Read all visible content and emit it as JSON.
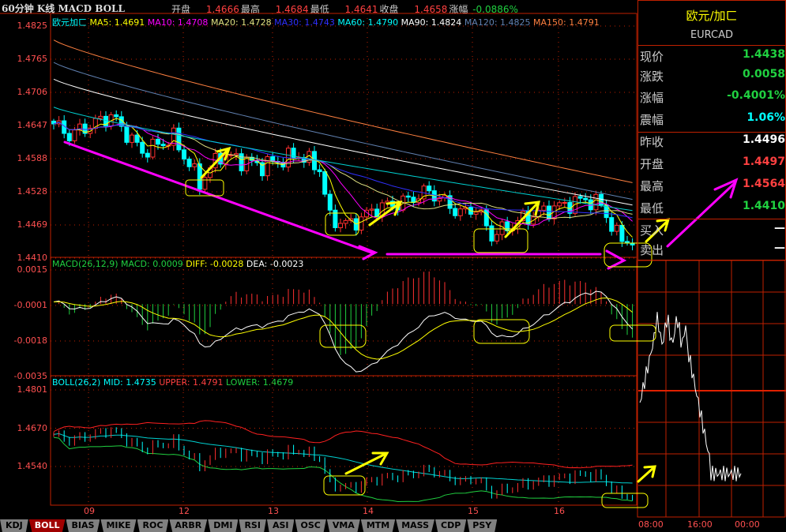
{
  "header": {
    "title": "60分钟 K线 MACD BOLL",
    "open_label": "开盘",
    "open": "1.4666",
    "high_label": "最高",
    "high": "1.4684",
    "low_label": "最低",
    "low": "1.4641",
    "close_label": "收盘",
    "close": "1.4658",
    "change_label": "涨幅",
    "change": "-0.0886%"
  },
  "main_legend": {
    "name": "欧元加ㄈ",
    "ma5": "MA5: 1.4691",
    "ma10": "MA10: 1.4708",
    "ma20": "MA20: 1.4728",
    "ma30": "MA30: 1.4743",
    "ma60": "MA60: 1.4790",
    "ma90": "MA90: 1.4824",
    "ma120": "MA120: 1.4825",
    "ma150": "MA150: 1.4791"
  },
  "macd_legend": {
    "name": "MACD(26,12,9)",
    "macd": "MACD: 0.0009",
    "diff": "DIFF: -0.0028",
    "dea": "DEA: -0.0023"
  },
  "boll_legend": {
    "name": "BOLL(26,2)",
    "mid": "MID: 1.4735",
    "upper": "UPPER: 1.4791",
    "lower": "LOWER: 1.4679"
  },
  "price_axis": [
    "1.4825",
    "1.4765",
    "1.4706",
    "1.4647",
    "1.4588",
    "1.4528",
    "1.4469",
    "1.4410"
  ],
  "macd_axis": [
    "0.0015",
    "-0.0001",
    "-0.0018",
    "-0.0035"
  ],
  "boll_axis": [
    "1.4801",
    "1.4670",
    "1.4540"
  ],
  "time_axis": [
    "09",
    "12",
    "13",
    "14",
    "15",
    "16"
  ],
  "tabs": [
    "KDJ",
    "BOLL",
    "BIAS",
    "MIKE",
    "ROC",
    "ARBR",
    "DMI",
    "RSI",
    "ASI",
    "OSC",
    "VMA",
    "MTM",
    "MASS",
    "CDP",
    "PSY"
  ],
  "active_tab": "BOLL",
  "quote": {
    "name": "欧元/加ㄈ",
    "code": "EURCAD",
    "rows": [
      {
        "k": "现价",
        "v": "1.4438",
        "c": "#20d040"
      },
      {
        "k": "涨跌",
        "v": "0.0058",
        "c": "#20d040"
      },
      {
        "k": "涨幅",
        "v": "-0.4001%",
        "c": "#20d040"
      },
      {
        "k": "震幅",
        "v": "1.06%",
        "c": "#00ffff"
      },
      {
        "k": "昨收",
        "v": "1.4496",
        "c": "#ffffff"
      },
      {
        "k": "开盘",
        "v": "1.4497",
        "c": "#ff4040"
      },
      {
        "k": "最高",
        "v": "1.4564",
        "c": "#ff4040"
      },
      {
        "k": "最低",
        "v": "1.4410",
        "c": "#20d040"
      },
      {
        "k": "买入",
        "v": "—",
        "c": "#ffffff"
      },
      {
        "k": "卖出",
        "v": "—",
        "c": "#ffffff"
      }
    ]
  },
  "mini_time_axis": [
    "08:00",
    "16:00",
    "00:00"
  ],
  "chart_data": {
    "type": "candlestick",
    "approx_close_keypoints": [
      [
        0,
        1.465
      ],
      [
        3,
        1.463
      ],
      [
        11,
        1.4665
      ],
      [
        17,
        1.46
      ],
      [
        23,
        1.4625
      ],
      [
        28,
        1.4545
      ],
      [
        32,
        1.4595
      ],
      [
        40,
        1.4575
      ],
      [
        47,
        1.4595
      ],
      [
        51,
        1.457
      ],
      [
        53,
        1.448
      ],
      [
        57,
        1.447
      ],
      [
        62,
        1.45
      ],
      [
        67,
        1.451
      ],
      [
        72,
        1.453
      ],
      [
        78,
        1.449
      ],
      [
        81,
        1.45
      ],
      [
        84,
        1.445
      ],
      [
        90,
        1.448
      ],
      [
        96,
        1.45
      ],
      [
        102,
        1.4515
      ],
      [
        105,
        1.4505
      ],
      [
        108,
        1.445
      ],
      [
        111,
        1.4438
      ]
    ],
    "long_ma": {
      "MA60": [
        1.468,
        1.4495
      ],
      "MA90": [
        1.473,
        1.4505
      ],
      "MA120": [
        1.476,
        1.4515
      ],
      "MA150": [
        1.48,
        1.4545
      ]
    },
    "ylim_price": [
      1.441,
      1.4825
    ],
    "ylim_macd": [
      -0.0035,
      0.0015
    ],
    "ylim_boll": [
      1.441,
      1.4801
    ]
  },
  "colors": {
    "up": "#ff3030",
    "down": "#00ffff",
    "grid": "#c02000",
    "ma5": "#ffff00",
    "ma10": "#ff00ff",
    "ma20": "#e0e080",
    "ma30": "#3030ff",
    "ma60": "#00d0d0",
    "ma90": "#ffffff",
    "ma120": "#6080b0",
    "ma150": "#ff8040"
  }
}
